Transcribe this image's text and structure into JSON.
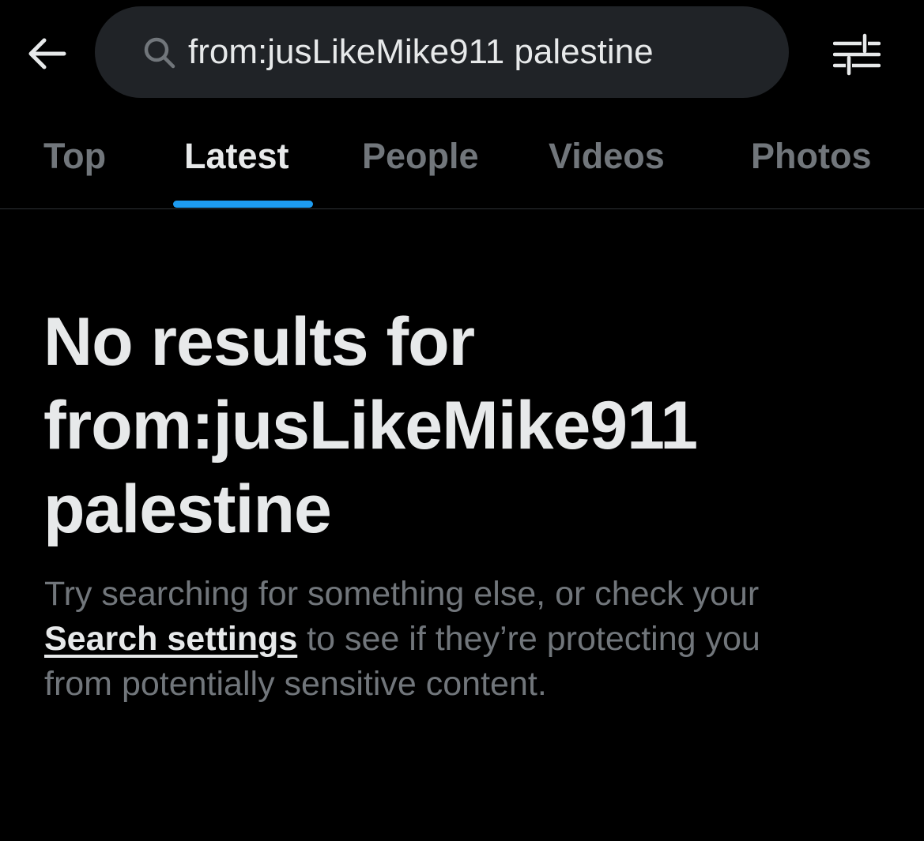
{
  "header": {
    "back_icon": "arrow-left-icon",
    "search": {
      "icon": "search-icon",
      "value": "from:jusLikeMike911 palestine"
    },
    "filter_icon": "sliders-icon"
  },
  "tabs": [
    {
      "label": "Top",
      "active": false
    },
    {
      "label": "Latest",
      "active": true
    },
    {
      "label": "People",
      "active": false
    },
    {
      "label": "Videos",
      "active": false
    },
    {
      "label": "Photos",
      "active": false
    }
  ],
  "empty_state": {
    "title": "No results for from:jusLikeMike911 palestine",
    "body_before_link": "Try searching for something else, or check your ",
    "link_label": "Search settings",
    "body_after_link": " to see if they’re protecting you from potentially sensitive content."
  },
  "colors": {
    "background": "#000000",
    "primary_text": "#e7e9ea",
    "secondary_text": "#71767b",
    "search_pill": "#202327",
    "accent": "#1d9bf0"
  }
}
